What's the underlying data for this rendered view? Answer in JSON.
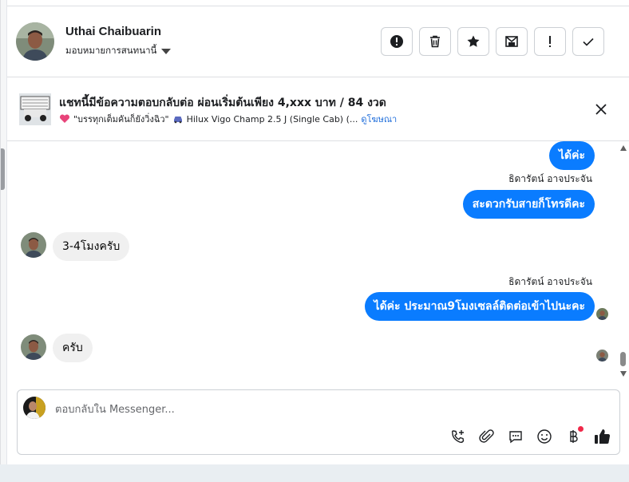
{
  "header": {
    "name": "Uthai Chaibuarin",
    "assign_label": "มอบหมายการสนทนานี้",
    "actions": [
      {
        "icon": "exclamation-circle-icon"
      },
      {
        "icon": "trash-icon"
      },
      {
        "icon": "star-icon"
      },
      {
        "icon": "mail-unread-icon"
      },
      {
        "icon": "exclamation-icon"
      },
      {
        "icon": "checkmark-icon"
      }
    ]
  },
  "ad": {
    "title": "แชทนี้มีข้อความตอบกลับต่อ ผ่อนเริ่มต้นเพียง 4,xxx บาท / 84 งวด",
    "subtitle": "\"บรรทุกเต็มคันก็ยังวิ่งฉิว\"",
    "vehicle": "Hilux Vigo Champ 2.5 J (Single Cab) (...",
    "link": "ดูโฆษณา"
  },
  "messages": [
    {
      "direction": "out",
      "text": "ได้ค่ะ"
    },
    {
      "direction": "out",
      "sender": "ธิดารัตน์ อาจประจัน",
      "text": "สะดวกรับสายก็โทรดีคะ"
    },
    {
      "direction": "in",
      "text": "3-4โมงครับ"
    },
    {
      "direction": "out",
      "sender": "ธิดารัตน์ อาจประจัน",
      "text": "ได้ค่ะ ประมาณ9โมงเซลล์ติดต่อเข้าไปนะคะ"
    },
    {
      "direction": "in",
      "text": "ครับ"
    }
  ],
  "composer": {
    "placeholder": "ตอบกลับใน Messenger...",
    "tools": [
      "phone-add-icon",
      "paperclip-icon",
      "chat-bubble-icon",
      "emoji-icon",
      "baht-icon",
      "thumbs-up-icon"
    ]
  },
  "colors": {
    "accent": "#0a7cff",
    "incoming_bubble": "#f0f0f0",
    "notification": "#f02849"
  }
}
